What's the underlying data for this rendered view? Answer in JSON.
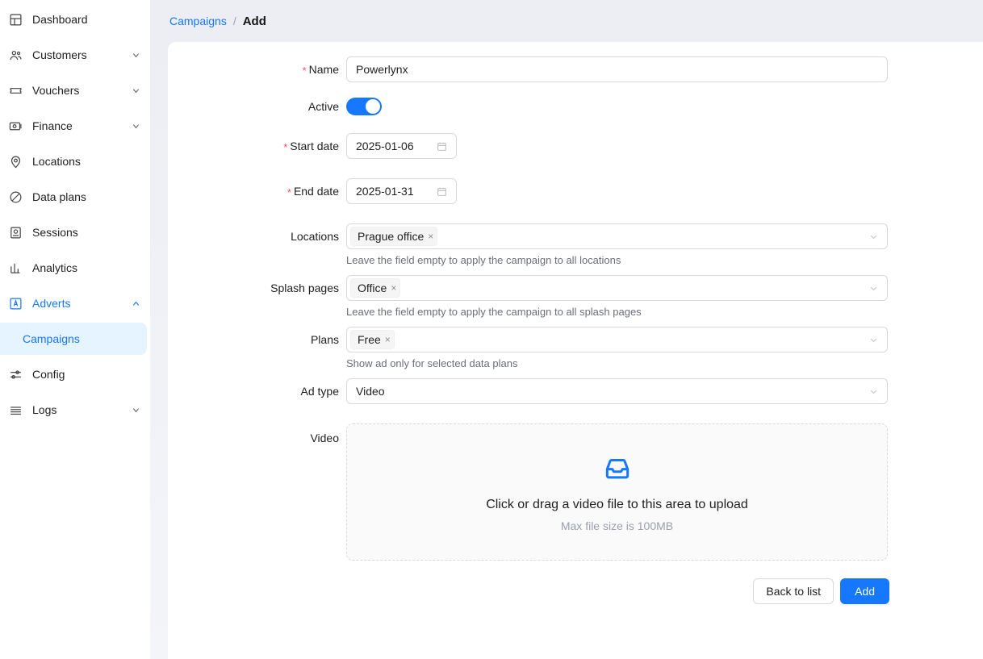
{
  "sidebar": {
    "items": [
      {
        "label": "Dashboard",
        "icon": "dashboard-icon",
        "has_chevron": false,
        "active": false
      },
      {
        "label": "Customers",
        "icon": "customers-icon",
        "has_chevron": true,
        "chevron": "down",
        "active": false
      },
      {
        "label": "Vouchers",
        "icon": "voucher-ticket-icon",
        "has_chevron": true,
        "chevron": "down",
        "active": false
      },
      {
        "label": "Finance",
        "icon": "finance-money-icon",
        "has_chevron": true,
        "chevron": "down",
        "active": false
      },
      {
        "label": "Locations",
        "icon": "location-pin-icon",
        "has_chevron": false,
        "active": false
      },
      {
        "label": "Data plans",
        "icon": "data-plans-icon",
        "has_chevron": false,
        "active": false
      },
      {
        "label": "Sessions",
        "icon": "sessions-icon",
        "has_chevron": false,
        "active": false
      },
      {
        "label": "Analytics",
        "icon": "analytics-bar-icon",
        "has_chevron": false,
        "active": false
      },
      {
        "label": "Adverts",
        "icon": "adverts-icon",
        "has_chevron": true,
        "chevron": "up",
        "active": true
      },
      {
        "label": "Config",
        "icon": "config-sliders-icon",
        "has_chevron": false,
        "active": false
      },
      {
        "label": "Logs",
        "icon": "logs-lines-icon",
        "has_chevron": true,
        "chevron": "down",
        "active": false
      }
    ],
    "subitems": [
      {
        "label": "Campaigns",
        "selected": true
      }
    ]
  },
  "breadcrumb": {
    "parent": "Campaigns",
    "separator": "/",
    "current": "Add"
  },
  "form": {
    "name": {
      "label": "Name",
      "required": true,
      "value": "Powerlynx"
    },
    "active": {
      "label": "Active",
      "required": false,
      "on": true
    },
    "start_date": {
      "label": "Start date",
      "required": true,
      "value": "2025-01-06",
      "icon": "calendar-icon"
    },
    "end_date": {
      "label": "End date",
      "required": true,
      "value": "2025-01-31",
      "icon": "calendar-icon"
    },
    "locations": {
      "label": "Locations",
      "required": false,
      "tags": [
        "Prague office"
      ],
      "hint": "Leave the field empty to apply the campaign to all locations"
    },
    "splash_pages": {
      "label": "Splash pages",
      "required": false,
      "tags": [
        "Office"
      ],
      "hint": "Leave the field empty to apply the campaign to all splash pages"
    },
    "plans": {
      "label": "Plans",
      "required": false,
      "tags": [
        "Free"
      ],
      "hint": "Show ad only for selected data plans"
    },
    "ad_type": {
      "label": "Ad type",
      "required": false,
      "value": "Video"
    },
    "video": {
      "label": "Video",
      "required": false,
      "icon": "inbox-upload-icon",
      "primary_text": "Click or drag a video file to this area to upload",
      "secondary_text": "Max file size is 100MB"
    }
  },
  "footer": {
    "back_label": "Back to list",
    "submit_label": "Add"
  },
  "colors": {
    "accent": "#1677ff",
    "selected_bg": "#e6f4ff",
    "required_star": "#ff4d4f",
    "page_bg": "#f0f1f5",
    "border": "#d9d9d9"
  },
  "tag_close_glyph": "×"
}
